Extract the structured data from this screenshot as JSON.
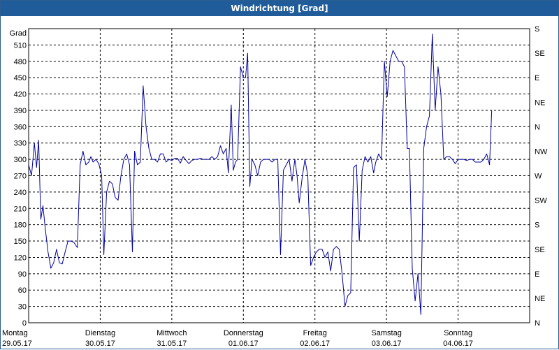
{
  "window": {
    "title": "Windrichtung [Grad]"
  },
  "chart_data": {
    "type": "line",
    "title": "Windrichtung [Grad]",
    "ylabel": "Grad",
    "ylim": [
      0,
      540
    ],
    "yticks": [
      0,
      30,
      60,
      90,
      120,
      150,
      180,
      210,
      240,
      270,
      300,
      330,
      360,
      390,
      420,
      450,
      480,
      510
    ],
    "right_axis_labels": [
      "S",
      "SE",
      "E",
      "NE",
      "N",
      "NW",
      "W",
      "SW",
      "S",
      "SE",
      "E",
      "NE",
      "N"
    ],
    "xlim": [
      0,
      7
    ],
    "x_ticks": [
      {
        "x": 0,
        "day": "Montag",
        "date": "29.05.17"
      },
      {
        "x": 1,
        "day": "Dienstag",
        "date": "30.05.17"
      },
      {
        "x": 2,
        "day": "Mittwoch",
        "date": "31.05.17"
      },
      {
        "x": 3,
        "day": "Donnerstag",
        "date": "01.06.17"
      },
      {
        "x": 4,
        "day": "Freitag",
        "date": "02.06.17"
      },
      {
        "x": 5,
        "day": "Samstag",
        "date": "03.06.17"
      },
      {
        "x": 6,
        "day": "Sonntag",
        "date": "04.06.17"
      }
    ],
    "grid": true,
    "line_color": "#0000a0",
    "series": [
      {
        "points": [
          [
            0.0,
            290
          ],
          [
            0.04,
            270
          ],
          [
            0.08,
            330
          ],
          [
            0.11,
            285
          ],
          [
            0.14,
            335
          ],
          [
            0.17,
            190
          ],
          [
            0.2,
            215
          ],
          [
            0.23,
            175
          ],
          [
            0.27,
            130
          ],
          [
            0.31,
            100
          ],
          [
            0.35,
            110
          ],
          [
            0.39,
            135
          ],
          [
            0.43,
            110
          ],
          [
            0.47,
            108
          ],
          [
            0.51,
            130
          ],
          [
            0.55,
            150
          ],
          [
            0.59,
            150
          ],
          [
            0.63,
            148
          ],
          [
            0.68,
            138
          ],
          [
            0.72,
            290
          ],
          [
            0.76,
            315
          ],
          [
            0.8,
            290
          ],
          [
            0.84,
            295
          ],
          [
            0.87,
            305
          ],
          [
            0.9,
            295
          ],
          [
            0.94,
            300
          ],
          [
            0.98,
            292
          ],
          [
            1.02,
            270
          ],
          [
            1.05,
            125
          ],
          [
            1.09,
            240
          ],
          [
            1.13,
            260
          ],
          [
            1.17,
            255
          ],
          [
            1.21,
            230
          ],
          [
            1.25,
            225
          ],
          [
            1.29,
            270
          ],
          [
            1.33,
            300
          ],
          [
            1.37,
            310
          ],
          [
            1.41,
            290
          ],
          [
            1.45,
            130
          ],
          [
            1.48,
            315
          ],
          [
            1.52,
            290
          ],
          [
            1.56,
            295
          ],
          [
            1.6,
            435
          ],
          [
            1.64,
            360
          ],
          [
            1.68,
            320
          ],
          [
            1.72,
            300
          ],
          [
            1.76,
            300
          ],
          [
            1.8,
            295
          ],
          [
            1.84,
            310
          ],
          [
            1.88,
            310
          ],
          [
            1.92,
            295
          ],
          [
            1.96,
            300
          ],
          [
            2.0,
            298
          ],
          [
            2.04,
            302
          ],
          [
            2.08,
            302
          ],
          [
            2.12,
            293
          ],
          [
            2.16,
            305
          ],
          [
            2.2,
            298
          ],
          [
            2.24,
            292
          ],
          [
            2.28,
            298
          ],
          [
            2.32,
            300
          ],
          [
            2.36,
            300
          ],
          [
            2.4,
            302
          ],
          [
            2.44,
            300
          ],
          [
            2.48,
            300
          ],
          [
            2.52,
            300
          ],
          [
            2.56,
            305
          ],
          [
            2.6,
            300
          ],
          [
            2.64,
            305
          ],
          [
            2.68,
            325
          ],
          [
            2.72,
            310
          ],
          [
            2.76,
            320
          ],
          [
            2.79,
            275
          ],
          [
            2.83,
            400
          ],
          [
            2.86,
            280
          ],
          [
            2.89,
            295
          ],
          [
            2.92,
            300
          ],
          [
            2.96,
            470
          ],
          [
            3.0,
            450
          ],
          [
            3.03,
            450
          ],
          [
            3.06,
            495
          ],
          [
            3.09,
            250
          ],
          [
            3.12,
            300
          ],
          [
            3.16,
            290
          ],
          [
            3.2,
            270
          ],
          [
            3.24,
            295
          ],
          [
            3.28,
            300
          ],
          [
            3.32,
            300
          ],
          [
            3.36,
            300
          ],
          [
            3.4,
            295
          ],
          [
            3.44,
            300
          ],
          [
            3.48,
            300
          ],
          [
            3.52,
            125
          ],
          [
            3.56,
            280
          ],
          [
            3.6,
            290
          ],
          [
            3.64,
            300
          ],
          [
            3.68,
            260
          ],
          [
            3.72,
            300
          ],
          [
            3.75,
            270
          ],
          [
            3.78,
            220
          ],
          [
            3.82,
            265
          ],
          [
            3.86,
            300
          ],
          [
            3.9,
            270
          ],
          [
            3.94,
            105
          ],
          [
            3.98,
            120
          ],
          [
            4.02,
            130
          ],
          [
            4.06,
            135
          ],
          [
            4.1,
            135
          ],
          [
            4.14,
            120
          ],
          [
            4.18,
            130
          ],
          [
            4.22,
            95
          ],
          [
            4.26,
            135
          ],
          [
            4.3,
            140
          ],
          [
            4.34,
            135
          ],
          [
            4.38,
            90
          ],
          [
            4.42,
            30
          ],
          [
            4.46,
            50
          ],
          [
            4.5,
            55
          ],
          [
            4.54,
            285
          ],
          [
            4.58,
            290
          ],
          [
            4.62,
            150
          ],
          [
            4.66,
            280
          ],
          [
            4.7,
            305
          ],
          [
            4.74,
            295
          ],
          [
            4.78,
            305
          ],
          [
            4.82,
            275
          ],
          [
            4.85,
            295
          ],
          [
            4.89,
            310
          ],
          [
            4.93,
            300
          ],
          [
            4.97,
            480
          ],
          [
            5.01,
            415
          ],
          [
            5.05,
            480
          ],
          [
            5.09,
            500
          ],
          [
            5.13,
            490
          ],
          [
            5.17,
            480
          ],
          [
            5.21,
            480
          ],
          [
            5.25,
            470
          ],
          [
            5.29,
            320
          ],
          [
            5.32,
            320
          ],
          [
            5.36,
            100
          ],
          [
            5.4,
            40
          ],
          [
            5.44,
            90
          ],
          [
            5.48,
            15
          ],
          [
            5.52,
            320
          ],
          [
            5.56,
            360
          ],
          [
            5.6,
            380
          ],
          [
            5.64,
            530
          ],
          [
            5.68,
            390
          ],
          [
            5.72,
            470
          ],
          [
            5.76,
            420
          ],
          [
            5.8,
            300
          ],
          [
            5.84,
            305
          ],
          [
            5.88,
            305
          ],
          [
            5.92,
            300
          ],
          [
            5.96,
            292
          ],
          [
            6.0,
            300
          ],
          [
            6.04,
            300
          ],
          [
            6.08,
            300
          ],
          [
            6.12,
            298
          ],
          [
            6.16,
            300
          ],
          [
            6.2,
            300
          ],
          [
            6.24,
            295
          ],
          [
            6.28,
            295
          ],
          [
            6.32,
            295
          ],
          [
            6.36,
            300
          ],
          [
            6.4,
            310
          ],
          [
            6.44,
            290
          ],
          [
            6.47,
            390
          ]
        ]
      }
    ]
  }
}
